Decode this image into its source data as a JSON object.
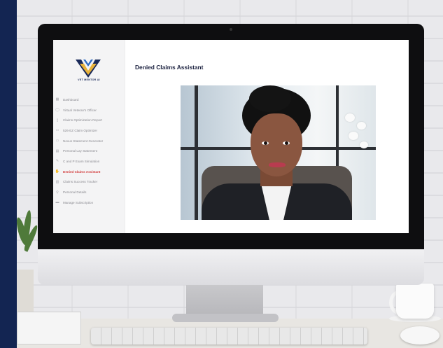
{
  "app": {
    "logo_text": "VET MENTOR AI",
    "page_title": "Denied Claims Assistant"
  },
  "sidebar": {
    "items": [
      {
        "label": "Dashboard",
        "icon": "grid-icon",
        "active": false
      },
      {
        "label": "Virtual Veteran's Officer",
        "icon": "user-icon",
        "active": false
      },
      {
        "label": "Claims Optimization Report",
        "icon": "report-icon",
        "active": false
      },
      {
        "label": "526-EZ Claim Optimizer",
        "icon": "form-icon",
        "active": false
      },
      {
        "label": "Nexus Statement Generator",
        "icon": "link-icon",
        "active": false
      },
      {
        "label": "Personal Lay Statement",
        "icon": "document-icon",
        "active": false
      },
      {
        "label": "C and P Exam Simulation",
        "icon": "edit-icon",
        "active": false
      },
      {
        "label": "Denied Claims Assistant",
        "icon": "thumbs-down-icon",
        "active": true
      },
      {
        "label": "Claims Success Tracker",
        "icon": "tracker-icon",
        "active": false
      },
      {
        "label": "Personal Details",
        "icon": "person-icon",
        "active": false
      },
      {
        "label": "Manage Subscription",
        "icon": "card-icon",
        "active": false
      }
    ]
  },
  "colors": {
    "accent_active": "#d23b3b",
    "title": "#1c2240",
    "sidebar_bg": "#f4f4f5",
    "outer_frame": "#0f1f4a"
  }
}
